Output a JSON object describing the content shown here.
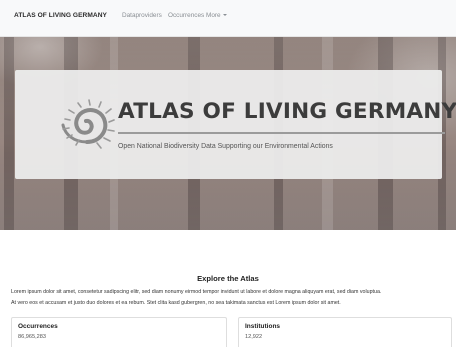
{
  "navbar": {
    "brand": "ATLAS OF LIVING GERMANY",
    "links": [
      "Dataproviders",
      "Occurrences",
      "More"
    ]
  },
  "hero": {
    "title": "ATLAS OF LIVING GERMANY",
    "subtitle": "Open National Biodiversity Data Supporting our Environmental Actions",
    "logo_icon": "ammonite-fossil-icon"
  },
  "explore": {
    "title": "Explore the Atlas",
    "lines": [
      "Lorem ipsum dolor sit amet, consetetur sadipscing elitr, sed diam nonumy eirmod tempor invidunt ut labore et dolore magna aliquyam erat, sed diam voluptua.",
      "At vero eos et accusam et justo duo dolores et ea rebum. Stet clita kasd gubergren, no sea takimata sanctus est Lorem ipsum dolor sit amet."
    ]
  },
  "stats": [
    {
      "label": "Occurrences",
      "value": "86,965,283"
    },
    {
      "label": "Institutions",
      "value": "12,922"
    }
  ],
  "colors": {
    "navbar_bg": "#f8f9fa",
    "hero_card_bg": "#ececec",
    "title_text": "#3c3c3c"
  }
}
